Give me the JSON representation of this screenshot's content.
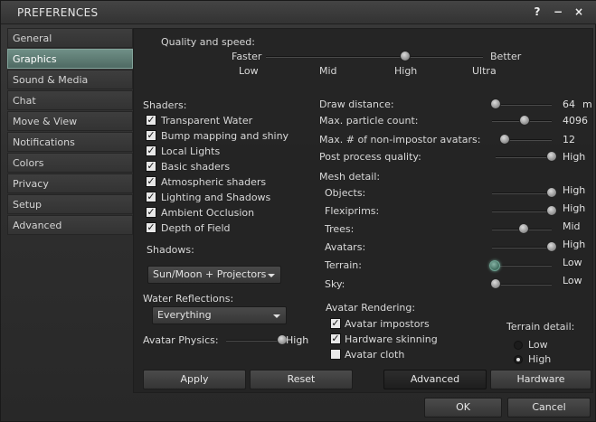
{
  "window": {
    "title": "PREFERENCES",
    "help_label": "?",
    "minimize_label": "−",
    "close_label": "×"
  },
  "sidebar": {
    "items": [
      {
        "label": "General"
      },
      {
        "label": "Graphics"
      },
      {
        "label": "Sound & Media"
      },
      {
        "label": "Chat"
      },
      {
        "label": "Move & View"
      },
      {
        "label": "Notifications"
      },
      {
        "label": "Colors"
      },
      {
        "label": "Privacy"
      },
      {
        "label": "Setup"
      },
      {
        "label": "Advanced"
      }
    ],
    "selected": "Graphics"
  },
  "quality": {
    "label": "Quality and speed:",
    "faster": "Faster",
    "better": "Better",
    "ticks": [
      "Low",
      "Mid",
      "High",
      "Ultra"
    ],
    "value": "High"
  },
  "shaders": {
    "label": "Shaders:",
    "items": [
      {
        "label": "Transparent Water",
        "checked": true
      },
      {
        "label": "Bump mapping and shiny",
        "checked": true
      },
      {
        "label": "Local Lights",
        "checked": true
      },
      {
        "label": "Basic shaders",
        "checked": true
      },
      {
        "label": "Atmospheric shaders",
        "checked": true
      },
      {
        "label": "Lighting and Shadows",
        "checked": true
      },
      {
        "label": "Ambient Occlusion",
        "checked": true
      },
      {
        "label": "Depth of Field",
        "checked": true
      }
    ],
    "check_glyph": "✓"
  },
  "shadows": {
    "label": "Shadows:",
    "value": "Sun/Moon + Projectors"
  },
  "water": {
    "label": "Water Reflections:",
    "value": "Everything"
  },
  "physics": {
    "label": "Avatar Physics:",
    "value": "High",
    "level": 1.0
  },
  "draw_distance": {
    "label": "Draw distance:",
    "value": "64",
    "unit": "m",
    "level": 0.0
  },
  "particles": {
    "label": "Max. particle count:",
    "value": "4096",
    "level": 0.5
  },
  "avatars_max": {
    "label": "Max. # of non-impostor avatars:",
    "value": "12",
    "level": 0.0
  },
  "post_process": {
    "label": "Post process quality:",
    "value": "High",
    "level": 1.0
  },
  "mesh": {
    "label": "Mesh detail:",
    "items": [
      {
        "label": "Objects:",
        "value": "High",
        "level": 1.0
      },
      {
        "label": "Flexiprims:",
        "value": "High",
        "level": 1.0
      },
      {
        "label": "Trees:",
        "value": "Mid",
        "level": 0.5
      },
      {
        "label": "Avatars:",
        "value": "High",
        "level": 1.0
      },
      {
        "label": "Terrain:",
        "value": "Low",
        "level": 0.0
      },
      {
        "label": "Sky:",
        "value": "Low",
        "level": 0.0
      }
    ]
  },
  "avatar_rendering": {
    "label": "Avatar Rendering:",
    "items": [
      {
        "label": "Avatar impostors",
        "checked": true
      },
      {
        "label": "Hardware skinning",
        "checked": true
      },
      {
        "label": "Avatar cloth",
        "checked": false
      }
    ]
  },
  "terrain_detail": {
    "label": "Terrain detail:",
    "options": [
      "Low",
      "High"
    ],
    "selected": "High"
  },
  "buttons": {
    "apply": "Apply",
    "reset": "Reset",
    "advanced": "Advanced",
    "hardware": "Hardware",
    "ok": "OK",
    "cancel": "Cancel"
  },
  "colors": {
    "accent": "#5f7f77",
    "background": "#2b2b2b"
  }
}
